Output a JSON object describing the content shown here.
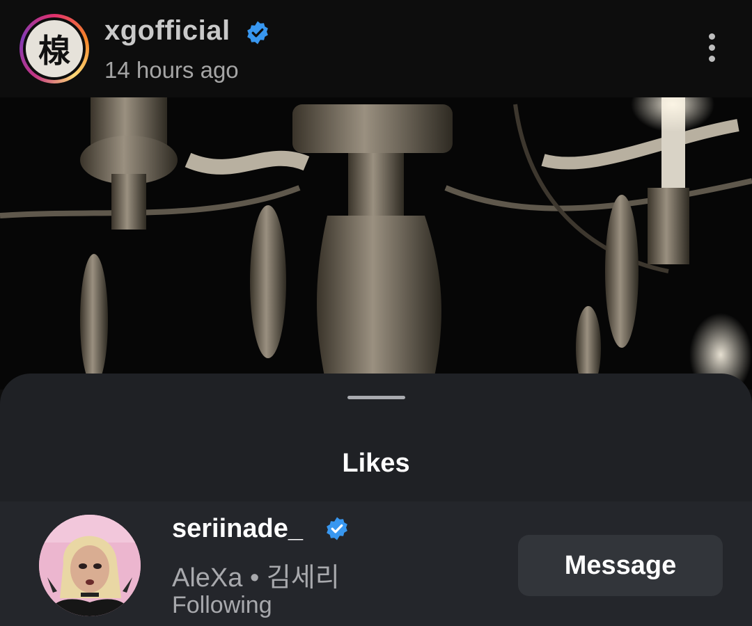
{
  "post": {
    "username": "xgofficial",
    "timestamp": "14 hours ago",
    "logo_glyph": "楾"
  },
  "icons": {
    "verified": "verified-badge-icon",
    "more": "more-options-icon"
  },
  "likes_sheet": {
    "title": "Likes",
    "users": [
      {
        "username": "seriinade_",
        "subtitle": "AleXa • 김세리",
        "status": "Following",
        "action_label": "Message"
      }
    ]
  },
  "colors": {
    "verified_blue": "#3897f0",
    "sheet_bg": "#1f2125",
    "button_bg": "#32353a"
  }
}
